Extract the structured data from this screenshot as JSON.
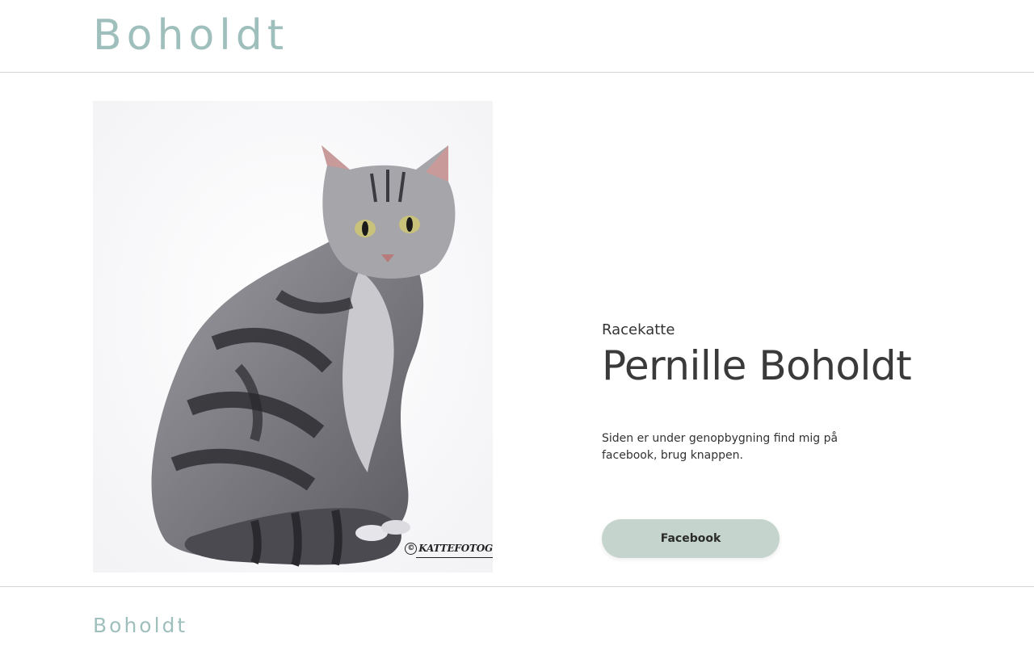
{
  "header": {
    "logo_text": "Boholdt"
  },
  "hero": {
    "image_alt": "Silver tabby cat sitting",
    "watermark": "KATTEFOTOG"
  },
  "content": {
    "eyebrow": "Racekatte",
    "title": "Pernille Boholdt",
    "body": "Siden er under genopbygning find mig på facebook, brug knappen.",
    "button_label": "Facebook"
  },
  "footer": {
    "logo_text": "Boholdt"
  },
  "colors": {
    "brand": "#9fbfbd",
    "button_bg": "#c5d4cc",
    "text": "#333333"
  }
}
